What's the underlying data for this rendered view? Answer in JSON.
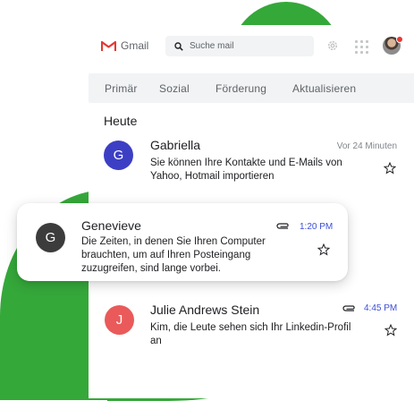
{
  "colors": {
    "accent_green": "#35a83a",
    "time_blue": "#3c4fd6",
    "avatar_gabriella": "#3c3fc4",
    "avatar_genevieve": "#3c3c3c",
    "avatar_julie": "#ea5a5a"
  },
  "header": {
    "logo_text": "Gmail",
    "search_placeholder": "Suche mail",
    "icons": [
      "gmail-logo-icon",
      "search-icon",
      "gear-icon",
      "apps-grid-icon",
      "user-avatar"
    ]
  },
  "tabs": [
    {
      "label": "Primär"
    },
    {
      "label": "Sozial"
    },
    {
      "label": "Förderung"
    },
    {
      "label": "Aktualisieren"
    }
  ],
  "section_title": "Heute",
  "emails": [
    {
      "initial": "G",
      "sender": "Gabriella",
      "time": "Vor 24 Minuten",
      "snippet": "Sie können Ihre Kontakte und E-Mails von Yahoo, Hotmail importieren",
      "has_attachment": false
    },
    {
      "initial": "G",
      "sender": "Genevieve",
      "time": "1:20 PM",
      "snippet": "Die Zeiten, in denen Sie Ihren Computer brauchten, um auf Ihren Posteingang zuzugreifen, sind lange vorbei.",
      "has_attachment": true
    },
    {
      "initial": "J",
      "sender": "Julie Andrews Stein",
      "time": "4:45 PM",
      "snippet": "Kim, die Leute sehen sich Ihr Linkedin-Profil an",
      "has_attachment": true
    }
  ]
}
